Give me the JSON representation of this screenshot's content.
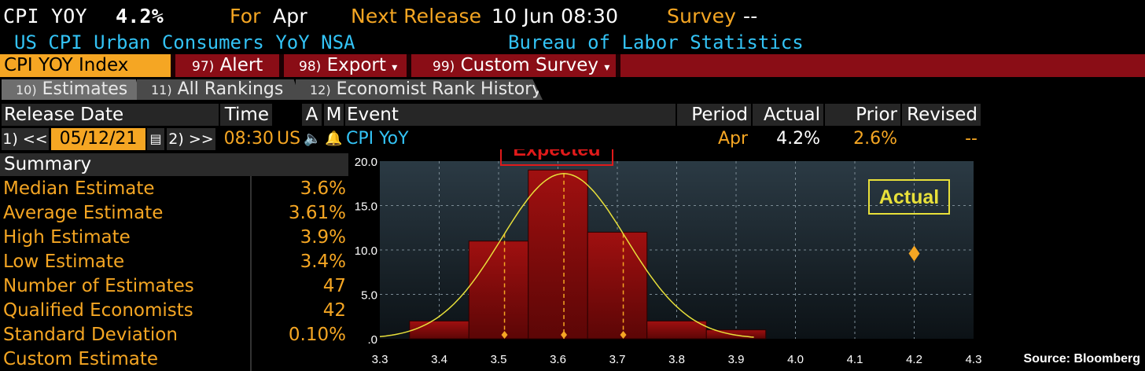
{
  "header": {
    "ticker": "CPI YOY",
    "value": "4.2%",
    "for_label": "For",
    "for_value": "Apr",
    "next_release_label": "Next Release",
    "next_release_value": "10 Jun 08:30",
    "survey_label": "Survey",
    "survey_value": "--",
    "description": "US CPI Urban Consumers YoY NSA",
    "source_org": "Bureau of Labor Statistics"
  },
  "menu": {
    "security": "CPI YOY Index",
    "items": [
      {
        "num": "97)",
        "label": "Alert"
      },
      {
        "num": "98)",
        "label": "Export",
        "caret": "▾"
      },
      {
        "num": "99)",
        "label": "Custom Survey",
        "caret": "▾"
      }
    ]
  },
  "tabs": [
    {
      "num": "10)",
      "label": "Estimates"
    },
    {
      "num": "11)",
      "label": "All Rankings"
    },
    {
      "num": "12)",
      "label": "Economist Rank History"
    }
  ],
  "table": {
    "headers": {
      "release_date": "Release Date",
      "time": "Time",
      "a": "A",
      "m": "M",
      "event": "Event",
      "period": "Period",
      "actual": "Actual",
      "prior": "Prior",
      "revised": "Revised"
    },
    "row": {
      "prev_btn": "1) <<",
      "date": "05/12/21",
      "next_btn": "2) >>",
      "time": "08:30",
      "country": "US",
      "event": "CPI YoY",
      "period": "Apr",
      "actual": "4.2%",
      "prior": "2.6%",
      "revised": "--"
    }
  },
  "summary": {
    "title": "Summary",
    "rows": [
      {
        "label": "Median Estimate",
        "value": "3.6%"
      },
      {
        "label": "Average Estimate",
        "value": "3.61%"
      },
      {
        "label": "High Estimate",
        "value": "3.9%"
      },
      {
        "label": "Low Estimate",
        "value": "3.4%"
      },
      {
        "label": "Number of Estimates",
        "value": "47"
      },
      {
        "label": "Qualified Economists",
        "value": "42"
      },
      {
        "label": "Standard Deviation",
        "value": "0.10%"
      },
      {
        "label": "Custom Estimate",
        "value": ""
      }
    ]
  },
  "chart_data": {
    "type": "bar",
    "x_ticks": [
      "3.3",
      "3.4",
      "3.5",
      "3.6",
      "3.7",
      "3.8",
      "3.9",
      "4.0",
      "4.1",
      "4.2",
      "4.3"
    ],
    "y_ticks": [
      "20.0",
      "15.0",
      "10.0",
      "5.0",
      ".0"
    ],
    "xlim": [
      3.3,
      4.3
    ],
    "ylim": [
      0,
      20
    ],
    "bars": [
      {
        "x0": 3.35,
        "x1": 3.45,
        "value": 2
      },
      {
        "x0": 3.45,
        "x1": 3.55,
        "value": 11
      },
      {
        "x0": 3.55,
        "x1": 3.65,
        "value": 19
      },
      {
        "x0": 3.65,
        "x1": 3.75,
        "value": 12
      },
      {
        "x0": 3.75,
        "x1": 3.85,
        "value": 2
      },
      {
        "x0": 3.85,
        "x1": 3.95,
        "value": 1
      }
    ],
    "curve": {
      "mean": 3.61,
      "peak": 18.6,
      "sd": 0.105
    },
    "expected_markers": [
      3.51,
      3.61,
      3.71
    ],
    "actual_marker": {
      "x": 4.2,
      "y": 9.6
    },
    "labels": {
      "expected": "Expected",
      "actual": "Actual"
    },
    "colors": {
      "bar": "#8e0a0a",
      "curve": "#e8e03a",
      "marker": "#f5a623",
      "actual_box": "#e8e03a",
      "expected_box": "#e01a1a"
    }
  },
  "source_note": "Source: Bloomberg"
}
